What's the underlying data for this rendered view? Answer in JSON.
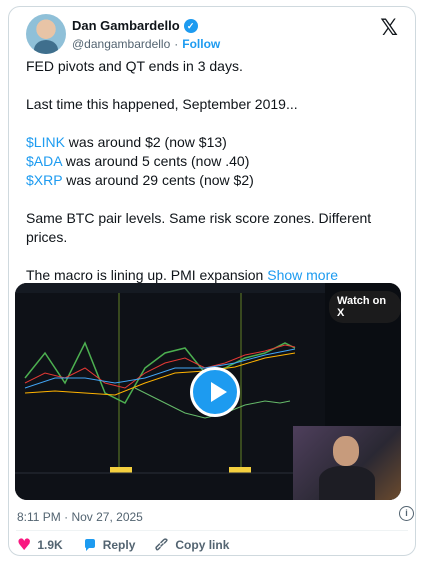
{
  "author": {
    "name": "Dan Gambardello",
    "handle": "@dangambardello",
    "separator": "·",
    "follow_label": "Follow"
  },
  "tweet": {
    "line1": "FED pivots and QT ends in 3 days.",
    "line2": "Last time this happened, September 2019...",
    "items": [
      {
        "tag": "$LINK",
        "text": " was around $2 (now $13)"
      },
      {
        "tag": "$ADA",
        "text": " was around 5 cents (now .40)"
      },
      {
        "tag": "$XRP",
        "text": " was around 29 cents (now $2)"
      }
    ],
    "line3": "Same BTC pair levels. Same risk score zones. Different prices.",
    "line4": "The macro is lining up. PMI expansion",
    "show_more": "Show more"
  },
  "media": {
    "watch_label": "Watch on X"
  },
  "meta": {
    "timestamp": "8:11 PM · Nov 27, 2025",
    "info_icon": "i"
  },
  "actions": {
    "likes": "1.9K",
    "reply_label": "Reply",
    "copy_link_label": "Copy link"
  },
  "colors": {
    "accent": "#1d9bf0",
    "like": "#f91880"
  }
}
